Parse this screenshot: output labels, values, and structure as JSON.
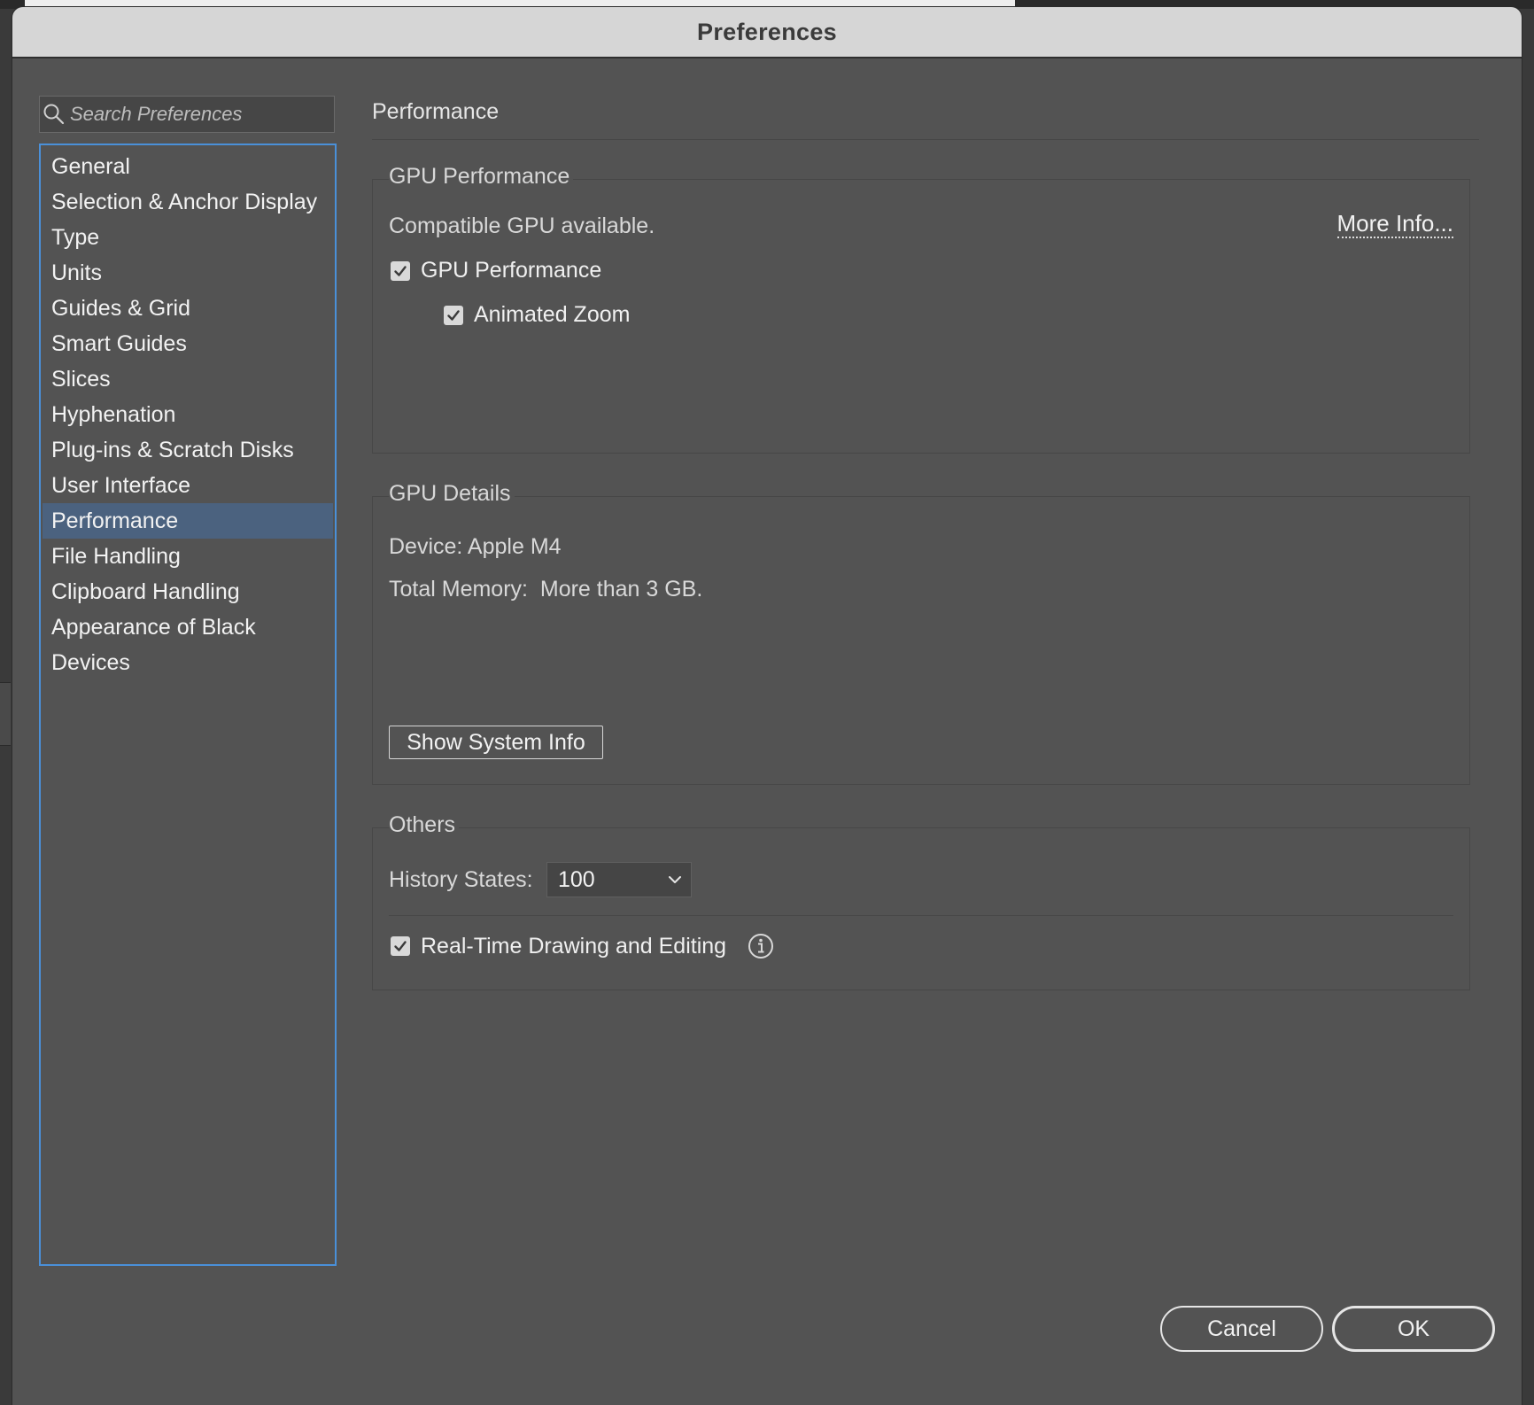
{
  "window": {
    "title": "Preferences"
  },
  "search": {
    "placeholder": "Search Preferences"
  },
  "sidebar": {
    "items": [
      {
        "label": "General"
      },
      {
        "label": "Selection & Anchor Display"
      },
      {
        "label": "Type"
      },
      {
        "label": "Units"
      },
      {
        "label": "Guides & Grid"
      },
      {
        "label": "Smart Guides"
      },
      {
        "label": "Slices"
      },
      {
        "label": "Hyphenation"
      },
      {
        "label": "Plug-ins & Scratch Disks"
      },
      {
        "label": "User Interface"
      },
      {
        "label": "Performance",
        "selected": true
      },
      {
        "label": "File Handling"
      },
      {
        "label": "Clipboard Handling"
      },
      {
        "label": "Appearance of Black"
      },
      {
        "label": "Devices"
      }
    ]
  },
  "main": {
    "title": "Performance",
    "gpu_performance": {
      "title": "GPU Performance",
      "status": "Compatible GPU available.",
      "more_info": "More Info...",
      "gpu_checkbox": {
        "label": "GPU Performance",
        "checked": true
      },
      "animated_zoom": {
        "label": "Animated Zoom",
        "checked": true
      }
    },
    "gpu_details": {
      "title": "GPU Details",
      "device": "Device: Apple M4",
      "memory": "Total Memory:  More than 3 GB.",
      "show_info_button": "Show System Info"
    },
    "others": {
      "title": "Others",
      "history_label": "History States:",
      "history_value": "100",
      "realtime": {
        "label": "Real-Time Drawing and Editing",
        "checked": true
      }
    }
  },
  "footer": {
    "cancel": "Cancel",
    "ok": "OK"
  },
  "colors": {
    "panel": "#535353",
    "titlebar": "#d6d6d6",
    "selection": "#4b627f",
    "focus": "#4a90d9"
  }
}
